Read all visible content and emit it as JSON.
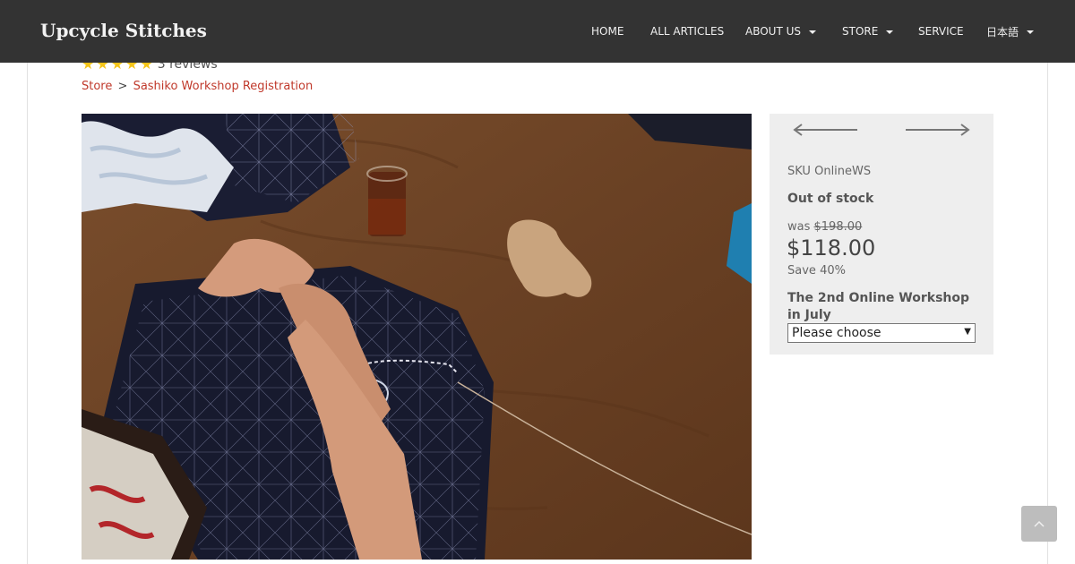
{
  "header": {
    "brand": "Upcycle Stitches",
    "nav": [
      {
        "label": "HOME"
      },
      {
        "label": "ALL ARTICLES"
      },
      {
        "label": "ABOUT US"
      },
      {
        "label": "STORE"
      },
      {
        "label": "SERVICE"
      },
      {
        "label": "日本語"
      }
    ]
  },
  "rating": {
    "stars": 5,
    "reviews_text": "3 reviews",
    "star_color": "#f5c518"
  },
  "breadcrumb": {
    "store": "Store",
    "separator": ">",
    "current": "Sashiko Workshop Registration"
  },
  "product": {
    "sku_label": "SKU",
    "sku": "OnlineWS",
    "stock_status": "Out of stock",
    "was_label": "was",
    "was_price": "$198.00",
    "price": "$118.00",
    "save_label": "Save",
    "save_percent": "40%",
    "option_label": "The 2nd Online Workshop in July",
    "option_selected": "Please choose"
  },
  "colors": {
    "accent_link": "#c0392b",
    "header_bg": "#333333"
  },
  "icons": {
    "prev": "arrow-left-icon",
    "next": "arrow-right-icon",
    "to_top": "chevron-up-icon"
  }
}
